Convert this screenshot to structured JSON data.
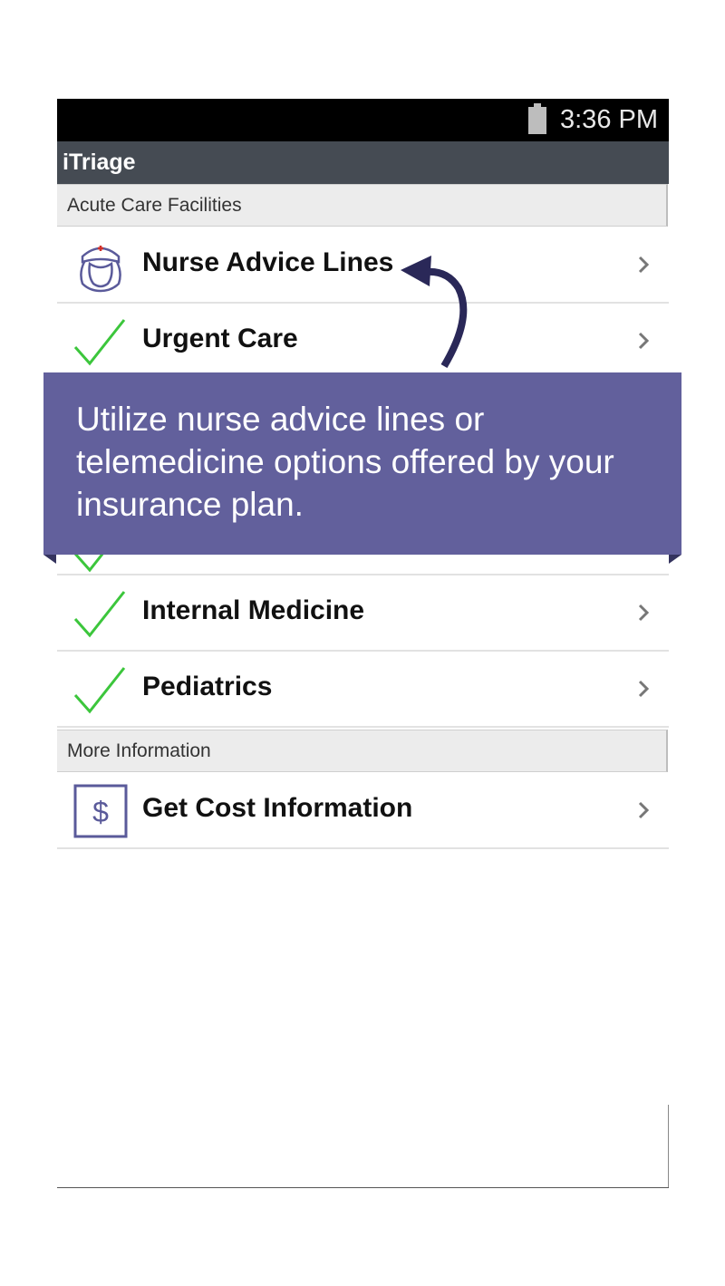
{
  "status_bar": {
    "time": "3:36 PM",
    "battery_icon": "battery-icon"
  },
  "app_bar": {
    "title": "iTriage"
  },
  "sections": {
    "acute": {
      "title": "Acute Care Facilities"
    },
    "more": {
      "title": "More Information"
    }
  },
  "rows": {
    "nurse": {
      "label": "Nurse Advice Lines",
      "icon": "nurse-icon"
    },
    "urgent": {
      "label": "Urgent Care",
      "icon": "check-icon"
    },
    "internal": {
      "label": "Internal Medicine",
      "icon": "check-icon"
    },
    "pediatrics": {
      "label": "Pediatrics",
      "icon": "check-icon"
    },
    "cost": {
      "label": "Get Cost Information",
      "icon": "dollar-icon"
    }
  },
  "overlay": {
    "text": "Utilize nurse advice lines or telemedicine options offered by your insurance plan."
  },
  "colors": {
    "overlay_bg": "#62609c",
    "check_green": "#3cc63c",
    "app_bar": "#454b53",
    "icon_purple": "#5a5a9a"
  }
}
